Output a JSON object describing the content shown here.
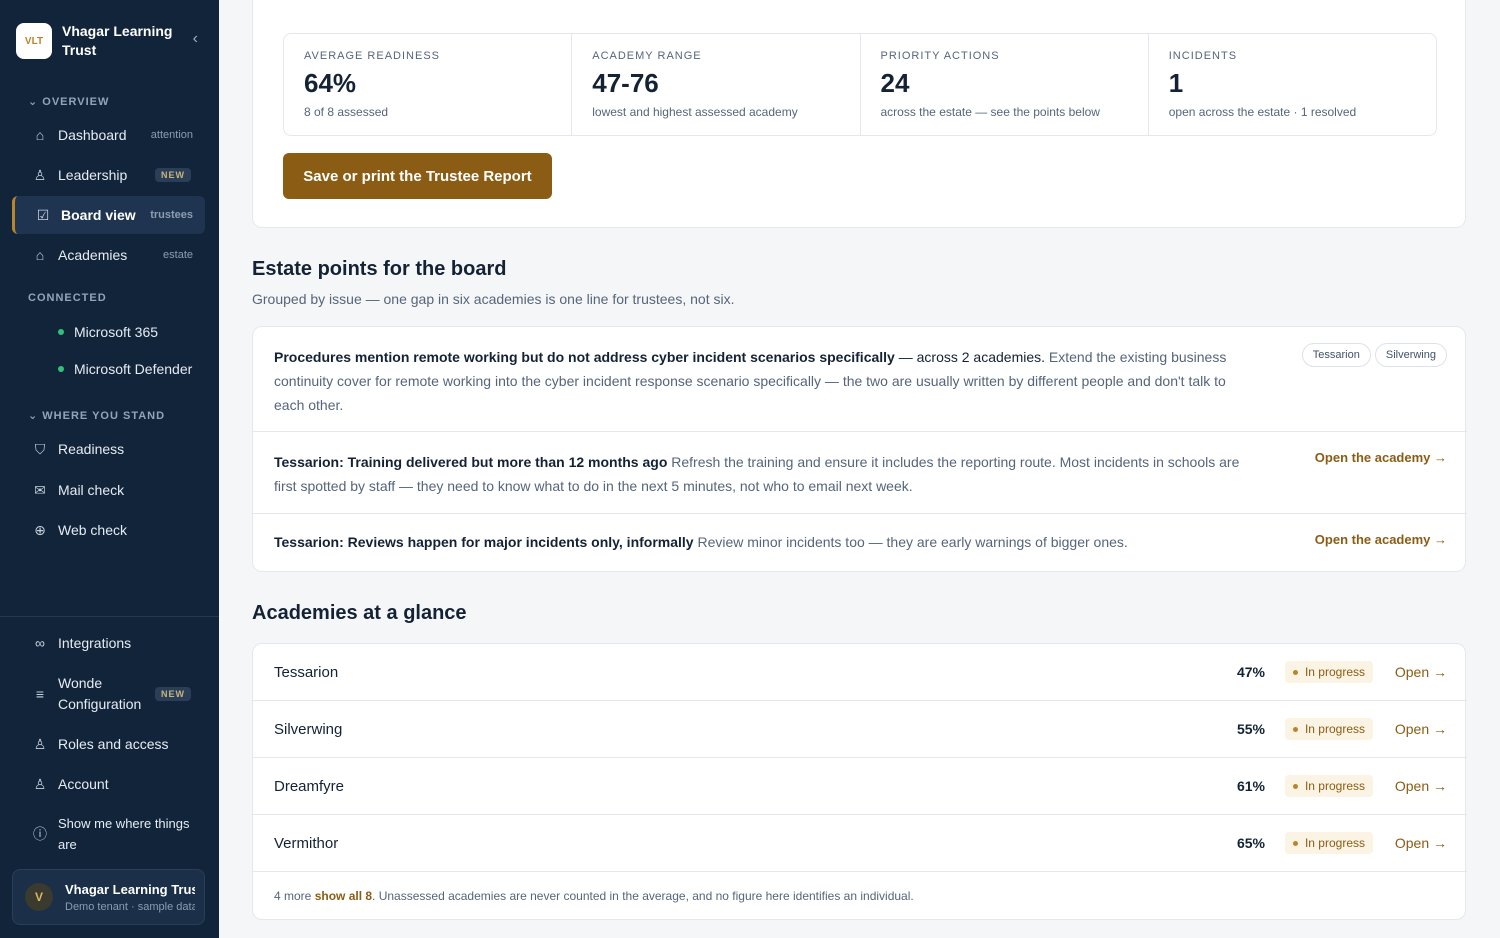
{
  "brand": {
    "name": "Vhagar Learning Trust",
    "logo": "VLT",
    "collapse": "‹"
  },
  "sidebar": {
    "overview_label": "OVERVIEW",
    "overview": [
      {
        "label": "Dashboard",
        "hint": "attention",
        "icon": "home-icon",
        "glyph": "⌂"
      },
      {
        "label": "Leadership",
        "badge": "NEW",
        "icon": "user-icon",
        "glyph": "♙"
      },
      {
        "label": "Board view",
        "hint": "trustees",
        "icon": "board-icon",
        "glyph": "☑"
      },
      {
        "label": "Academies",
        "hint": "estate",
        "icon": "building-icon",
        "glyph": "⌂"
      }
    ],
    "connected_label": "CONNECTED",
    "connected": [
      "Microsoft 365",
      "Microsoft Defender"
    ],
    "stand_label": "WHERE YOU STAND",
    "stand": [
      {
        "label": "Readiness",
        "icon": "shield-icon",
        "glyph": "⛉"
      },
      {
        "label": "Mail check",
        "icon": "mail-icon",
        "glyph": "✉"
      },
      {
        "label": "Web check",
        "icon": "globe-icon",
        "glyph": "⊕"
      }
    ],
    "bottom": [
      {
        "label": "Integrations",
        "icon": "link-icon",
        "glyph": "∞"
      },
      {
        "label": "Wonde Configuration",
        "badge": "NEW",
        "icon": "menu-icon",
        "glyph": "≡"
      },
      {
        "label": "Roles and access",
        "icon": "users-icon",
        "glyph": "♙"
      },
      {
        "label": "Account",
        "icon": "account-icon",
        "glyph": "♙"
      },
      {
        "label": "Show me where things are",
        "icon": "info-icon",
        "glyph": "ⓘ"
      }
    ],
    "tenant": {
      "avatar": "V",
      "name": "Vhagar Learning Trust",
      "sub": "Demo tenant · sample data"
    }
  },
  "stats": [
    {
      "label": "AVERAGE READINESS",
      "value": "64%",
      "sub": "8 of 8 assessed"
    },
    {
      "label": "ACADEMY RANGE",
      "value": "47-76",
      "sub": "lowest and highest assessed academy"
    },
    {
      "label": "PRIORITY ACTIONS",
      "value": "24",
      "sub": "across the estate — see the points below"
    },
    {
      "label": "INCIDENTS",
      "value": "1",
      "sub": "open across the estate · 1 resolved"
    }
  ],
  "report_button": "Save or print the Trustee Report",
  "points": {
    "title": "Estate points for the board",
    "subtitle": "Grouped by issue — one gap in six academies is one line for trustees, not six.",
    "items": [
      {
        "bold": "Procedures mention remote working but do not address cyber incident scenarios specifically",
        "mid": " — across 2 academies.",
        "rest": " Extend the existing business continuity cover for remote working into the cyber incident response scenario specifically — the two are usually written by different people and don't talk to each other.",
        "tags": [
          "Tessarion",
          "Silverwing"
        ]
      },
      {
        "bold": "Tessarion: Training delivered but more than 12 months ago",
        "rest": " Refresh the training and ensure it includes the reporting route. Most incidents in schools are first spotted by staff — they need to know what to do in the next 5 minutes, not who to email next week.",
        "link": "Open the academy →"
      },
      {
        "bold": "Tessarion: Reviews happen for major incidents only, informally",
        "rest": " Review minor incidents too — they are early warnings of bigger ones.",
        "link": "Open the academy →"
      }
    ]
  },
  "academies": {
    "title": "Academies at a glance",
    "rows": [
      {
        "name": "Tessarion",
        "pct": "47%",
        "status": "In progress",
        "open": "Open →"
      },
      {
        "name": "Silverwing",
        "pct": "55%",
        "status": "In progress",
        "open": "Open →"
      },
      {
        "name": "Dreamfyre",
        "pct": "61%",
        "status": "In progress",
        "open": "Open →"
      },
      {
        "name": "Vermithor",
        "pct": "65%",
        "status": "In progress",
        "open": "Open →"
      }
    ],
    "footer_prefix": "4 more ",
    "footer_link": "show all 8",
    "footer_rest": ". Unassessed academies are never counted in the average, and no figure here identifies an individual."
  }
}
